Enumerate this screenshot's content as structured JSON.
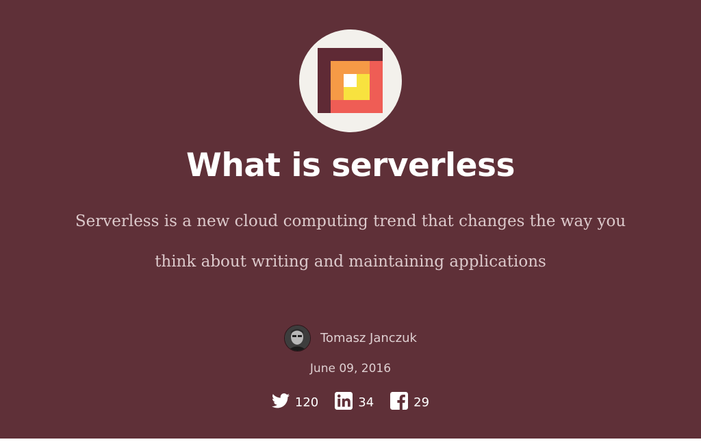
{
  "header": {
    "logo_icon": "serverless-logo-icon",
    "title": "What is serverless",
    "subtitle": "Serverless is a new cloud computing trend that changes the way you think about writing and maintaining applications"
  },
  "author": {
    "avatar_icon": "author-avatar",
    "name": "Tomasz Janczuk",
    "date": "June 09, 2016"
  },
  "shares": [
    {
      "network": "twitter",
      "icon": "twitter-icon",
      "count": "120"
    },
    {
      "network": "linkedin",
      "icon": "linkedin-icon",
      "count": "34"
    },
    {
      "network": "facebook",
      "icon": "facebook-icon",
      "count": "29"
    }
  ],
  "colors": {
    "hero_background": "#5f3038",
    "logo_background": "#f3f1ec",
    "logo_maroon": "#5f2a35",
    "logo_coral": "#ef5d55",
    "logo_orange": "#f69a46",
    "logo_yellow": "#f8e23f"
  }
}
